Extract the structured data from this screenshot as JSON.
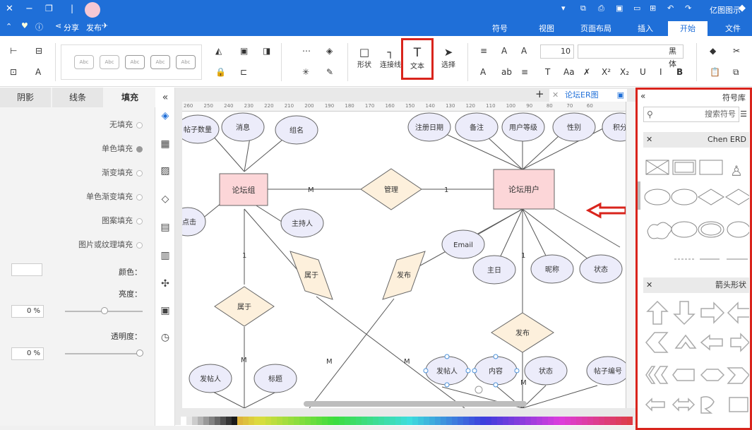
{
  "titlebar": {
    "app_name": "亿图图示"
  },
  "tabs": [
    "文件",
    "开始",
    "插入",
    "页面布局",
    "视图",
    "符号"
  ],
  "active_tab": "开始",
  "quick": {
    "share": "分享",
    "publish": "发布"
  },
  "ribbon": {
    "select": "选择",
    "text": "文本",
    "connector": "连接线",
    "shape": "形状",
    "font_name": "黑体",
    "font_size": "10",
    "style_sample": "Abc"
  },
  "left_panel": {
    "tabs": [
      "填充",
      "线条",
      "阴影"
    ],
    "active_tab": "填充",
    "fill_options": [
      "无填充",
      "单色填充",
      "渐变填充",
      "单色渐变填充",
      "图案填充",
      "图片或纹理填充"
    ],
    "selected_fill": "单色填充",
    "color_label": "颜色：",
    "brightness_label": "亮度：",
    "brightness_value": "0 %",
    "transparency_label": "透明度：",
    "transparency_value": "0 %"
  },
  "doc": {
    "tab_title": "论坛ER图"
  },
  "ruler_marks": [
    "260",
    "250",
    "240",
    "230",
    "220",
    "210",
    "200",
    "190",
    "180",
    "170",
    "160",
    "150",
    "140",
    "130",
    "120",
    "110",
    "100",
    "90",
    "80",
    "70",
    "60"
  ],
  "diagram": {
    "entities": [
      "论坛组",
      "论坛用户"
    ],
    "relations": [
      "管理",
      "属于",
      "属于",
      "发布",
      "发布"
    ],
    "attributes": [
      "帖子数量",
      "消息",
      "组名",
      "主持人",
      "点击",
      "注册日期",
      "备注",
      "用户等级",
      "性别",
      "积分",
      "Email",
      "主日",
      "昵称",
      "状态",
      "发帖人",
      "内容",
      "状态",
      "帖子编号",
      "发帖人",
      "标题"
    ],
    "cardinalities": [
      "M",
      "1",
      "1",
      "M",
      "M",
      "M",
      "1",
      "M"
    ]
  },
  "right_panel": {
    "title": "符号库",
    "search_placeholder": "搜索符号",
    "section1": "Chen ERD",
    "section2": "箭头形状"
  },
  "colors": {
    "brand": "#1f6fd8",
    "highlight": "#d9241c"
  }
}
